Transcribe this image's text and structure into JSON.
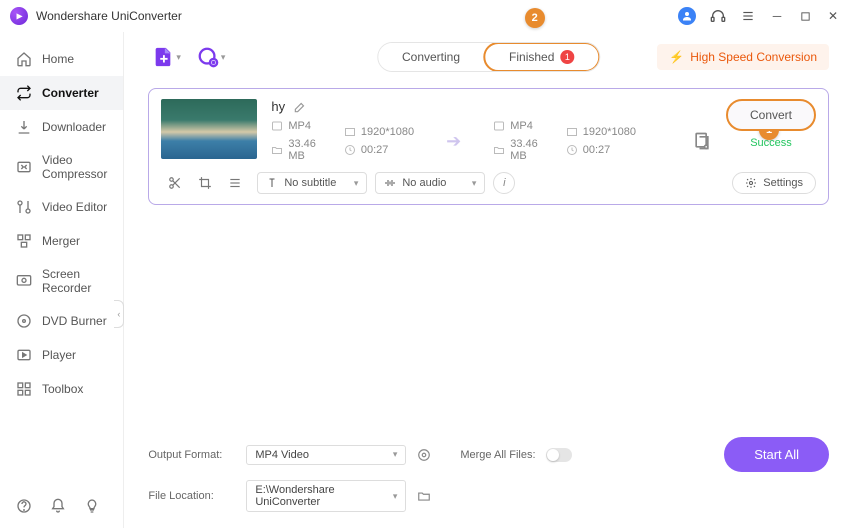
{
  "app": {
    "title": "Wondershare UniConverter"
  },
  "sidebar": {
    "items": [
      {
        "label": "Home"
      },
      {
        "label": "Converter"
      },
      {
        "label": "Downloader"
      },
      {
        "label": "Video Compressor"
      },
      {
        "label": "Video Editor"
      },
      {
        "label": "Merger"
      },
      {
        "label": "Screen Recorder"
      },
      {
        "label": "DVD Burner"
      },
      {
        "label": "Player"
      },
      {
        "label": "Toolbox"
      }
    ]
  },
  "tabs": {
    "converting": "Converting",
    "finished": "Finished",
    "finished_count": "1"
  },
  "callouts": {
    "one": "1",
    "two": "2"
  },
  "hs": "High Speed Conversion",
  "card": {
    "name": "hy",
    "src": {
      "format": "MP4",
      "res": "1920*1080",
      "size": "33.46 MB",
      "dur": "00:27"
    },
    "dst": {
      "format": "MP4",
      "res": "1920*1080",
      "size": "33.46 MB",
      "dur": "00:27"
    },
    "convert": "Convert",
    "status": "Success",
    "subtitle_label": "No subtitle",
    "audio_label": "No audio",
    "settings": "Settings"
  },
  "bottom": {
    "outfmt_label": "Output Format:",
    "outfmt_value": "MP4 Video",
    "loc_label": "File Location:",
    "loc_value": "E:\\Wondershare UniConverter",
    "merge_label": "Merge All Files:",
    "start_all": "Start All"
  }
}
